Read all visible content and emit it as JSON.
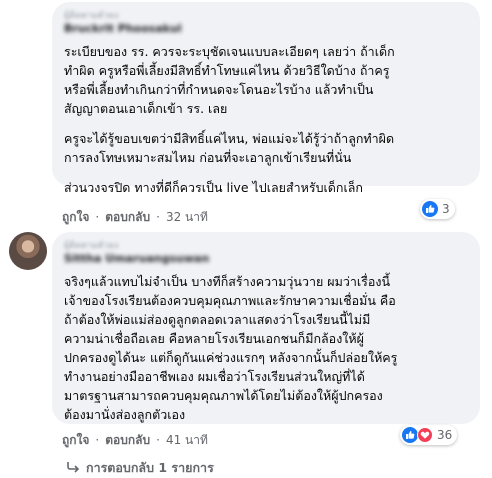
{
  "comments": [
    {
      "badge": "ผู้ติดตามตัวยง",
      "author": "Bruckrit Phoosakul",
      "paragraphs": [
        "ระเบียบของ รร. ควรจะระบุชัดเจนแบบละเอียดๆ เลยว่า ถ้าเด็ก\nทำผิด ครูหรือพี่เลี้ยงมีสิทธิ์ทำโทษแค่ไหน ด้วยวิธีใดบ้าง ถ้าครู\nหรือพี่เลี้ยงทำเกินกว่าที่กำหนดจะโดนอะไรบ้าง แล้วทำเป็น\nสัญญาตอนเอาเด็กเข้า รร. เลย",
        "ครูจะได้รู้ขอบเขตว่ามีสิทธิ์แค่ไหน, พ่อแม่จะได้รู้ว่าถ้าลูกทำผิด\nการลงโทษเหมาะสมไหม ก่อนที่จะเอาลูกเข้าเรียนที่นั่น",
        "ส่วนวงจรปิด ทางที่ดีก็ควรเป็น live ไปเลยสำหรับเด็กเล็ก"
      ],
      "like_label": "ถูกใจ",
      "reply_label": "ตอบกลับ",
      "time": "32 นาที",
      "reactions": {
        "icons": [
          "like-icon"
        ],
        "count": "3"
      }
    },
    {
      "badge": "ผู้ติดตามตัวยง",
      "author": "Sittha Umaruangsuwan",
      "paragraphs": [
        "จริงๆแล้วแทบไม่จำเป็น บางทีก็สร้างความวุ่นวาย ผมว่าเรื่องนี้\nเจ้าของโรงเรียนต้องควบคุมคุณภาพและรักษาความเชื่อมั่น คือ\nถ้าต้องให้พ่อแม่ส่องดูลูกตลอดเวลาแสดงว่าโรงเรียนนี้ไม่มี\nความน่าเชื่อถือเลย คือหลายโรงเรียนเอกชนก็มีกล้องให้ผู้\nปกครองดูได้นะ แต่ก็ดูกันแค่ช่วงแรกๆ หลังจากนั้นก็ปล่อยให้ครู\nทำงานอย่างมืออาชีพเอง ผมเชื่อว่าโรงเรียนส่วนใหญ่ที่ได้\nมาตรฐานสามารถควบคุมคุณภาพได้โดยไม่ต้องให้ผู้ปกครอง\nต้องมานั่งส่องลูกตัวเอง"
      ],
      "like_label": "ถูกใจ",
      "reply_label": "ตอบกลับ",
      "time": "41 นาที",
      "reactions": {
        "icons": [
          "like-icon",
          "heart-icon"
        ],
        "count": "36"
      }
    }
  ],
  "replies_link": "การตอบกลับ 1 รายการ",
  "colors": {
    "bubble": "#f0f2f5",
    "like": "#1877f2",
    "love": "#f33e58",
    "meta": "#65676b"
  }
}
